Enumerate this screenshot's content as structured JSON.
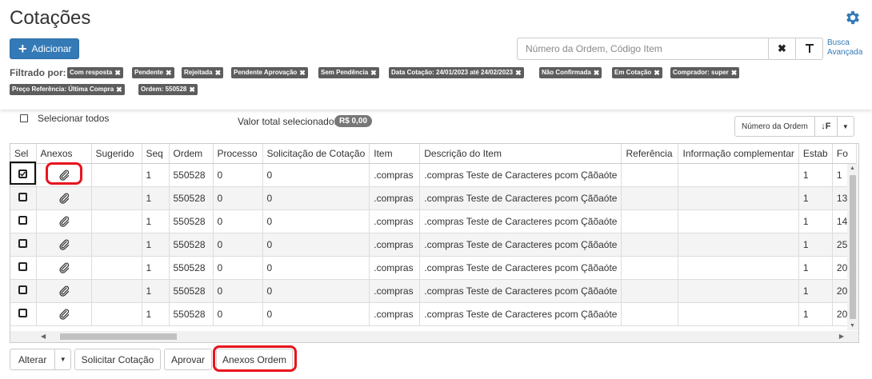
{
  "header": {
    "title": "Cotações",
    "add_button": "Adicionar",
    "search_placeholder": "Número da Ordem, Código Item",
    "clear_glyph": "✖",
    "filter_glyph": "⊤",
    "advanced_search": [
      "Busca",
      "Avançada"
    ]
  },
  "filters": {
    "label": "Filtrado por:",
    "chips": [
      "Com resposta",
      "Pendente",
      "Rejeitada",
      "Pendente Aprovação",
      "Sem Pendência",
      "Data Cotação: 24/01/2023 até 24/02/2023",
      "Não Confirmada",
      "Em Cotação",
      "Comprador: super",
      "Preço Referência: Última Compra",
      "Ordem: 550528"
    ]
  },
  "toolbar": {
    "select_all": "Selecionar todos",
    "total_label": "Valor total selecionado:",
    "total_value": "R$ 0,00",
    "sort_label": "Número da Ordem",
    "sort_icon": "↓F",
    "sort_caret": "▼"
  },
  "table": {
    "columns": [
      "Sel",
      "Anexos",
      "Sugerido",
      "Seq",
      "Ordem",
      "Processo",
      "Solicitação de Cotação",
      "Item",
      "Descrição do Item",
      "Referência",
      "Informação complementar",
      "Estab",
      "Fo"
    ],
    "rows": [
      {
        "seq": "1",
        "ordem": "550528",
        "processo": "0",
        "solicitacao": "0",
        "item": ".compras",
        "descricao": ".compras Teste de Caracteres pcom Çãõaóte",
        "estab": "1",
        "fo": "1"
      },
      {
        "seq": "1",
        "ordem": "550528",
        "processo": "0",
        "solicitacao": "0",
        "item": ".compras",
        "descricao": ".compras Teste de Caracteres pcom Çãõaóte",
        "estab": "1",
        "fo": "13"
      },
      {
        "seq": "1",
        "ordem": "550528",
        "processo": "0",
        "solicitacao": "0",
        "item": ".compras",
        "descricao": ".compras Teste de Caracteres pcom Çãõaóte",
        "estab": "1",
        "fo": "14"
      },
      {
        "seq": "1",
        "ordem": "550528",
        "processo": "0",
        "solicitacao": "0",
        "item": ".compras",
        "descricao": ".compras Teste de Caracteres pcom Çãõaóte",
        "estab": "1",
        "fo": "25"
      },
      {
        "seq": "1",
        "ordem": "550528",
        "processo": "0",
        "solicitacao": "0",
        "item": ".compras",
        "descricao": ".compras Teste de Caracteres pcom Çãõaóte",
        "estab": "1",
        "fo": "20"
      },
      {
        "seq": "1",
        "ordem": "550528",
        "processo": "0",
        "solicitacao": "0",
        "item": ".compras",
        "descricao": ".compras Teste de Caracteres pcom Çãõaóte",
        "estab": "1",
        "fo": "20"
      },
      {
        "seq": "1",
        "ordem": "550528",
        "processo": "0",
        "solicitacao": "0",
        "item": ".compras",
        "descricao": ".compras Teste de Caracteres pcom Çãõaóte",
        "estab": "1",
        "fo": "20"
      }
    ]
  },
  "actions": {
    "alterar": "Alterar",
    "solicitar": "Solicitar Cotação",
    "aprovar": "Aprovar",
    "anexos": "Anexos Ordem"
  },
  "colors": {
    "primary": "#337ab7",
    "chip": "#5d5d5d",
    "annotation": "#e8141d"
  }
}
